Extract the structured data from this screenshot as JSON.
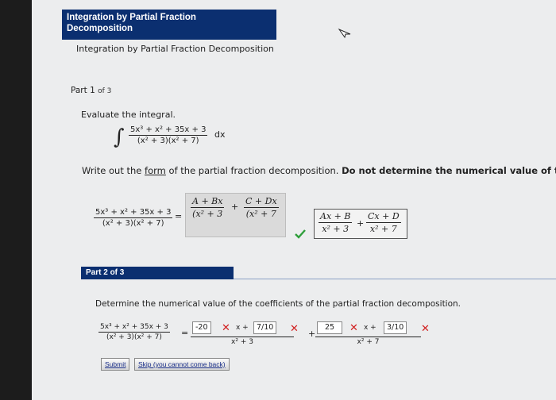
{
  "header": {
    "title_line1": "Integration by Partial Fraction",
    "title_line2": "Decomposition",
    "subtitle": "Integration by Partial Fraction Decomposition"
  },
  "part1": {
    "label": "Part 1",
    "of": "of 3",
    "prompt": "Evaluate the integral.",
    "integrand_numerator": "5x³ + x² + 35x + 3",
    "integrand_denominator": "(x² + 3)(x² + 7)",
    "dx": "dx",
    "write_prefix": "Write out the ",
    "write_link": "form",
    "write_middle": " of the partial fraction decomposition. ",
    "write_bold": "Do not determine the numerical value of the coeff",
    "lhs_numerator": "5x³ + x² + 35x + 3",
    "lhs_denominator": "(x² + 3)(x² + 7)",
    "equals": "=",
    "box_term1_num": "A + Bx",
    "box_term1_den": "(x² + 3",
    "box_plus": "+",
    "box_term2_num": "C + Dx",
    "box_term2_den": "(x² + 7",
    "ans_term1_num": "Ax + B",
    "ans_term1_den": "x² + 3",
    "ans_plus": "+",
    "ans_term2_num": "Cx + D",
    "ans_term2_den": "x² + 7"
  },
  "part2": {
    "label": "Part 2 of 3",
    "prompt": "Determine the numerical value of the coefficients of the partial fraction decomposition.",
    "lhs_numerator": "5x³ + x² + 35x + 3",
    "lhs_denominator": "(x² + 3)(x² + 7)",
    "equals": "=",
    "input1": "-20",
    "x_plus": "x +",
    "input2": "7/10",
    "den1": "x² + 3",
    "plus": "+",
    "input3": "25",
    "x_plus2": "x +",
    "input4": "3/10",
    "den2": "x² + 7",
    "x_mark": "✕"
  },
  "buttons": {
    "submit": "Submit",
    "skip": "Skip (you cannot come back)"
  },
  "colors": {
    "header_blue": "#0b2f70",
    "check_green": "#2e9e3a",
    "error_red": "#d11f1f"
  }
}
